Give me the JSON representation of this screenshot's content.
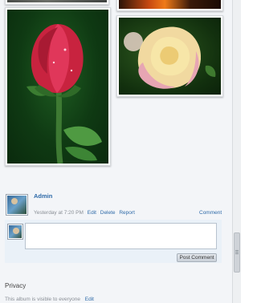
{
  "post": {
    "author": "Admin",
    "timestamp": "Yesterday at 7:20 PM",
    "actions": {
      "edit": "Edit",
      "delete": "Delete",
      "report": "Report"
    },
    "comment_link": "Comment"
  },
  "composer": {
    "textarea_value": "",
    "submit_label": "Post Comment"
  },
  "privacy": {
    "title": "Privacy",
    "text": "This album is visible to everyone",
    "edit_label": "Edit"
  },
  "colors": {
    "link": "#2e6aa8",
    "meta_text": "#8a8f96",
    "comment_box_bg": "#eaf1f8"
  }
}
